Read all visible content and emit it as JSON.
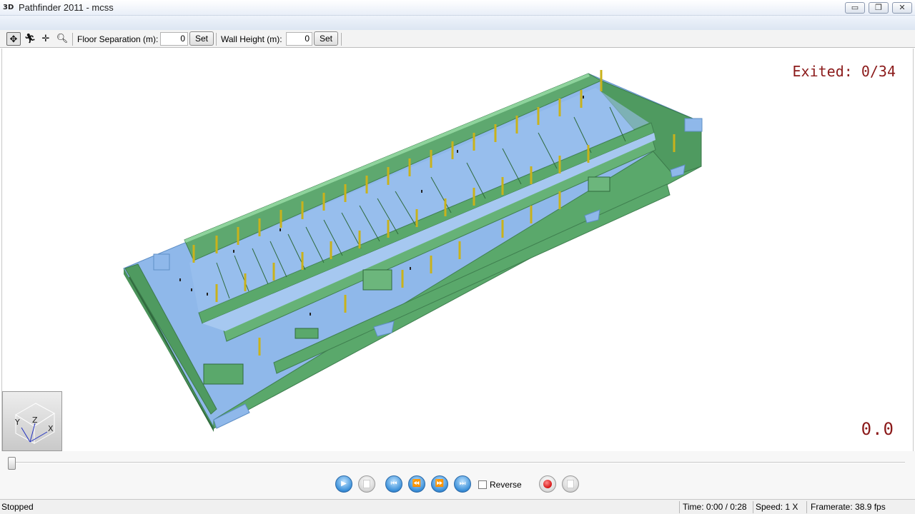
{
  "window": {
    "title": "Pathfinder 2011 - mcss",
    "icon_text": "3D",
    "minimize": "▭",
    "restore": "❐",
    "close": "✕"
  },
  "toolbar": {
    "floor_separation_label": "Floor Separation (m):",
    "floor_separation_value": "0",
    "set_label": "Set",
    "wall_height_label": "Wall Height (m):",
    "wall_height_value": "0",
    "set2_label": "Set",
    "tools": [
      "orbit-icon",
      "walk-icon",
      "pan-icon",
      "zoom-icon"
    ]
  },
  "viewport": {
    "exited_label": "Exited:",
    "exited_value": "0/34",
    "time_display": "0.0",
    "axis": {
      "y": "Y",
      "z": "Z",
      "x": "X"
    }
  },
  "playback": {
    "reverse_label": "Reverse",
    "progress": 0
  },
  "status": {
    "state": "Stopped",
    "time": "Time: 0:00 / 0:28",
    "speed": "Speed: 1 X",
    "framerate": "Framerate: 38.9 fps"
  },
  "colors": {
    "wall": "#5aa86b",
    "floor": "#8fb8ea",
    "door": "#c9b21b",
    "readout": "#8b1a1a"
  }
}
